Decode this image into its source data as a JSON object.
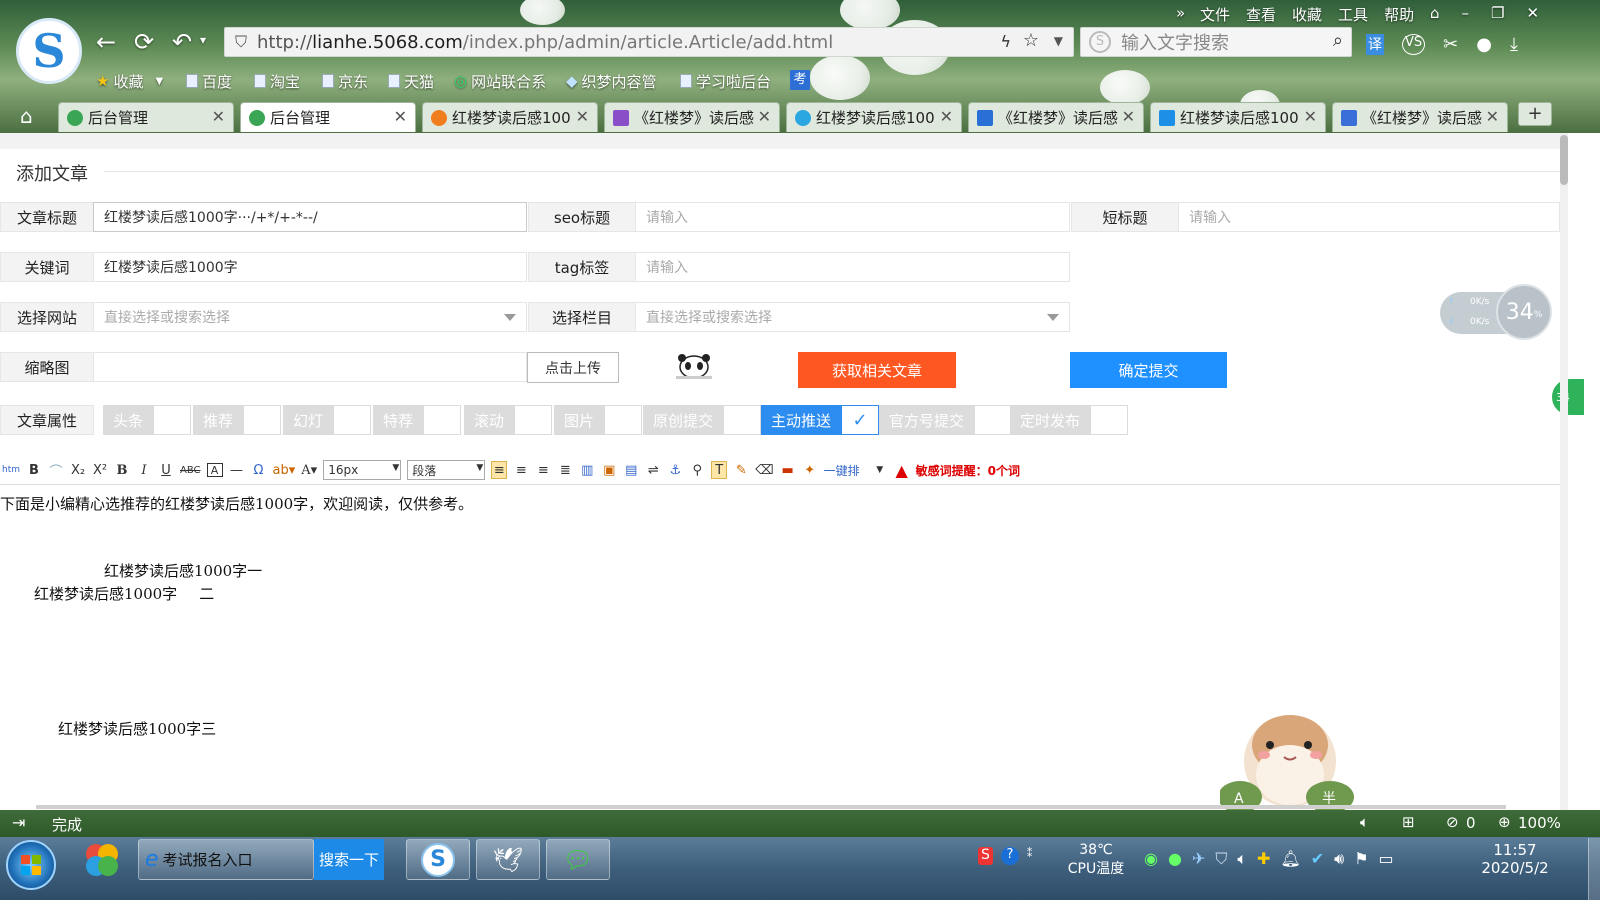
{
  "browser": {
    "menu": [
      "文件",
      "查看",
      "收藏",
      "工具",
      "帮助"
    ],
    "address": {
      "scheme": "http://",
      "host": "lianhe.5068.com",
      "path": "/index.php/admin/article.Article/add.html"
    },
    "search_placeholder": "输入文字搜索",
    "bookmarks": [
      "收藏",
      "百度",
      "淘宝",
      "京东",
      "天猫",
      "网站联合系",
      "织梦内容管",
      "学习啦后台"
    ],
    "tabs": [
      {
        "label": "后台管理",
        "color": "#3aa655"
      },
      {
        "label": "后台管理",
        "color": "#3aa655"
      },
      {
        "label": "红楼梦读后感100",
        "color": "#f07d1e"
      },
      {
        "label": "《红楼梦》读后感",
        "color": "#8a4fc8"
      },
      {
        "label": "红楼梦读后感100",
        "color": "#2aa7e0"
      },
      {
        "label": "《红楼梦》读后感",
        "color": "#2a6fd6"
      },
      {
        "label": "红楼梦读后感100",
        "color": "#1d8fe6"
      },
      {
        "label": "《红楼梦》读后感",
        "color": "#3a6ed8"
      }
    ],
    "newtab": "+"
  },
  "form": {
    "legend": "添加文章",
    "title_label": "文章标题",
    "title_value": "红楼梦读后感1000字···/+*/+-*--/",
    "seo_label": "seo标题",
    "seo_placeholder": "请输入",
    "short_label": "短标题",
    "short_placeholder": "请输入",
    "keyword_label": "关键词",
    "keyword_value": "红楼梦读后感1000字",
    "tag_label": "tag标签",
    "tag_placeholder": "请输入",
    "site_label": "选择网站",
    "site_placeholder": "直接选择或搜索选择",
    "column_label": "选择栏目",
    "column_placeholder": "直接选择或搜索选择",
    "thumb_label": "缩略图",
    "upload_button": "点击上传",
    "related_button": "获取相关文章",
    "submit_button": "确定提交",
    "attr_label": "文章属性",
    "attrs": [
      {
        "label": "头条",
        "checked": false
      },
      {
        "label": "推荐",
        "checked": false
      },
      {
        "label": "幻灯",
        "checked": false
      },
      {
        "label": "特荐",
        "checked": false
      },
      {
        "label": "滚动",
        "checked": false
      },
      {
        "label": "图片",
        "checked": false
      },
      {
        "label": "原创提交",
        "checked": false
      },
      {
        "label": "主动推送",
        "checked": true
      },
      {
        "label": "官方号提交",
        "checked": false
      },
      {
        "label": "定时发布",
        "checked": false
      }
    ]
  },
  "toolbar": {
    "font_size": "16px",
    "paragraph": "段落",
    "one_key": "一键排",
    "sensitive": "敏感词提醒：0个词"
  },
  "editor": {
    "intro": "下面是小编精心选推荐的红楼梦读后感1000字，欢迎阅读，仅供参考。",
    "h1": "红楼梦读后感1000字一",
    "h2a": "红楼梦读后感1000字",
    "h2b": "二",
    "h3": "红楼梦读后感1000字三"
  },
  "widget": {
    "percent": "34",
    "unit": "%",
    "up": "0K/s",
    "down": "0K/s",
    "side": "34"
  },
  "statusbar": {
    "text": "完成",
    "count": "0",
    "zoom": "100%"
  },
  "taskbar": {
    "ie_label": "考试报名入口",
    "search_label": "搜索一下",
    "temp": "38℃",
    "cpu": "CPU温度",
    "time": "11:57",
    "date": "2020/5/2"
  }
}
